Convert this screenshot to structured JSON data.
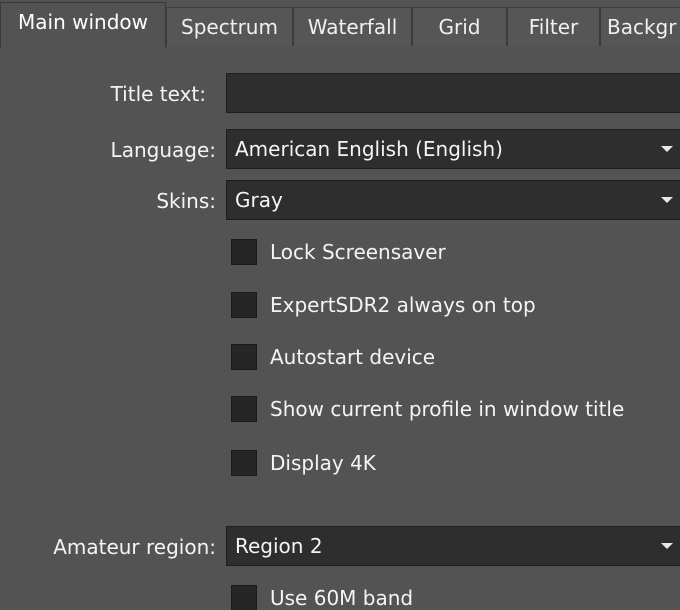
{
  "tabs": [
    {
      "label": "Main window",
      "active": true
    },
    {
      "label": "Spectrum",
      "active": false
    },
    {
      "label": "Waterfall",
      "active": false
    },
    {
      "label": "Grid",
      "active": false
    },
    {
      "label": "Filter",
      "active": false
    },
    {
      "label": "Backgr",
      "active": false
    }
  ],
  "form": {
    "title_text": {
      "label": "Title text:",
      "value": ""
    },
    "language": {
      "label": "Language:",
      "value": "American English (English)"
    },
    "skins": {
      "label": "Skins:",
      "value": "Gray"
    },
    "checkboxes": [
      {
        "label": "Lock Screensaver",
        "checked": false
      },
      {
        "label": "ExpertSDR2 always on top",
        "checked": false
      },
      {
        "label": "Autostart device",
        "checked": false
      },
      {
        "label": "Show current profile in window title",
        "checked": false
      },
      {
        "label": "Display 4K",
        "checked": false
      }
    ],
    "amateur_region": {
      "label": "Amateur region:",
      "value": "Region 2"
    },
    "band_checkbox": {
      "label": "Use 60M band",
      "checked": false
    }
  },
  "icons": {
    "dropdown": "chevron-down-icon",
    "checkbox": "checkbox-icon"
  },
  "colors": {
    "background": "#535353",
    "field_background": "#2e2e2e",
    "checkbox_background": "#262626",
    "text": "#f4f4f4"
  }
}
